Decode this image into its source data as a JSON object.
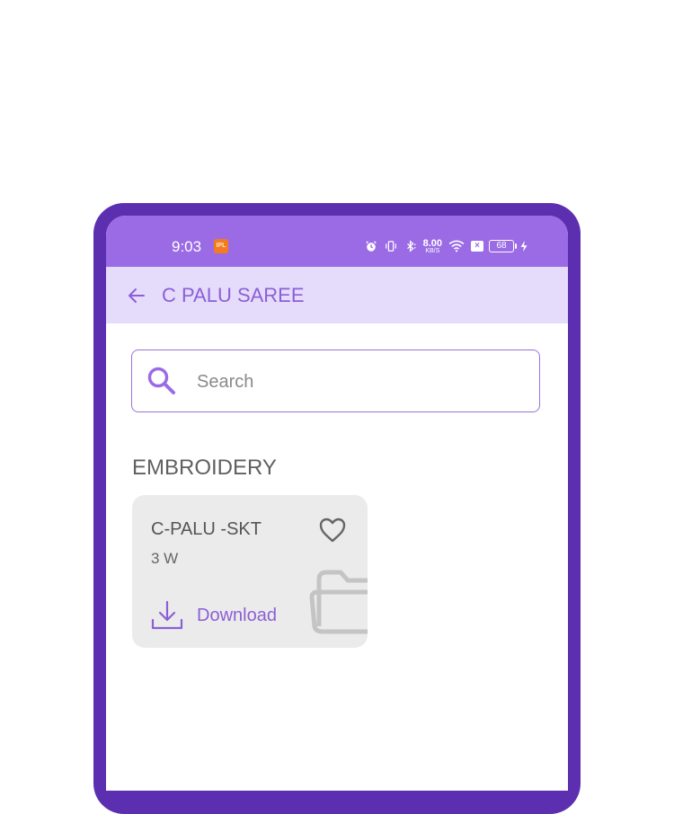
{
  "status_bar": {
    "time": "9:03",
    "app_badge": "IPL",
    "net_speed_value": "8.00",
    "net_speed_unit": "KB/S",
    "battery": "68"
  },
  "app_bar": {
    "title": "C PALU SAREE"
  },
  "search": {
    "placeholder": "Search",
    "value": ""
  },
  "section": {
    "title": "EMBROIDERY"
  },
  "cards": [
    {
      "title": "C-PALU -SKT",
      "subtitle": "3 W",
      "download_label": "Download"
    }
  ],
  "colors": {
    "frame": "#5c2fb0",
    "status_bar": "#9b6be6",
    "app_bar": "#e5dcfb",
    "accent": "#8c5fd6",
    "card_bg": "#ebebeb"
  }
}
